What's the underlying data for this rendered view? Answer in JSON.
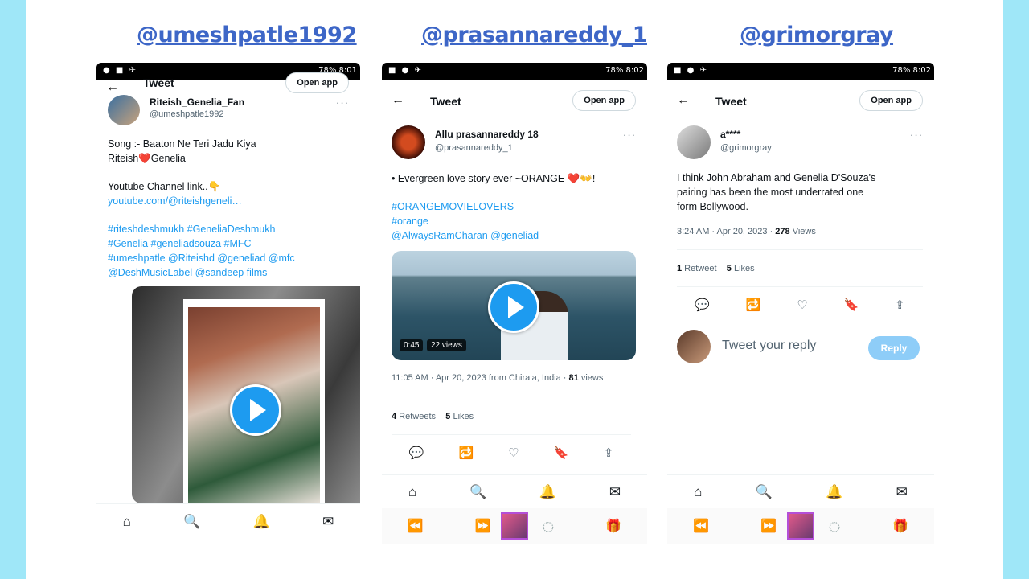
{
  "handles": [
    "@umeshpatle1992",
    "@prasannareddy_1",
    "@grimorgray"
  ],
  "colors": {
    "accent": "#1d9bf0",
    "handle": "#3d66c7",
    "frame": "#9fe7f8",
    "like": "#e0245e"
  },
  "statusbar": {
    "battery_1": "78% 8:01",
    "battery_2": "78% 8:02",
    "battery_3": "78% 8:02"
  },
  "topbar": {
    "title": "Tweet",
    "open_app": "Open app",
    "back_icon": "←"
  },
  "icons": {
    "more": "···",
    "reply": "💬",
    "retweet": "🔁",
    "like": "♡",
    "bookmark": "🔖",
    "share": "⇪",
    "home": "⌂",
    "search": "🔍",
    "bell": "🔔",
    "mail": "✉",
    "rewind": "⏪",
    "forward": "⏩",
    "loading": "◌",
    "gift": "🎁"
  },
  "tweet1": {
    "name": "Riteish_Genelia_Fan",
    "username": "@umeshpatle1992",
    "lines": [
      "Song :- Baaton Ne Teri Jadu Kiya",
      "Riteish❤️Genelia",
      "Youtube Channel link..👇",
      "youtube.com/@riteishgeneli…",
      "#riteshdeshmukh #GeneliaDeshmukh",
      "#Genelia #geneliadsouza #MFC",
      "#umeshpatle @Riteishd @geneliad @mfc",
      "@DeshMusicLabel @sandeep films"
    ]
  },
  "tweet2": {
    "name": "Allu prasannareddy 18",
    "username": "@prasannareddy_1",
    "lines": [
      "• Evergreen love story ever ~ORANGE ❤️👐!",
      "#ORANGEMOVIELOVERS",
      "#orange",
      " @AlwaysRamCharan @geneliad"
    ],
    "video_time": "0:45",
    "video_views": "22 views",
    "meta_time": "11:05 AM · Apr 20, 2023 from Chirala, India · ",
    "meta_views_num": "81",
    "meta_views_label": " views",
    "retweets_num": "4",
    "retweets_label": " Retweets",
    "likes_num": "5",
    "likes_label": " Likes"
  },
  "tweet3": {
    "name": "a****",
    "username": "@grimorgray",
    "lines": [
      "I think John Abraham and Genelia D'Souza's",
      "pairing has been the most underrated one",
      "form Bollywood."
    ],
    "meta_time": "3:24 AM · Apr 20, 2023 · ",
    "meta_views_num": "278",
    "meta_views_label": " Views",
    "retweets_num": "1",
    "retweets_label": " Retweet",
    "likes_num": "5",
    "likes_label": " Likes",
    "reply_placeholder": "Tweet your reply",
    "reply_button": "Reply"
  }
}
